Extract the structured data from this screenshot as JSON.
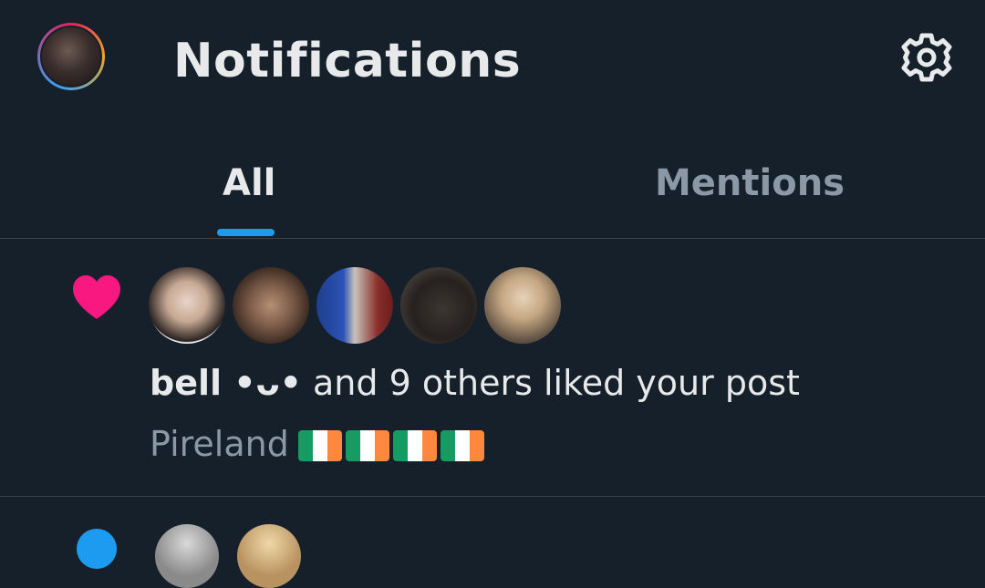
{
  "header": {
    "title": "Notifications",
    "settings_icon": "gear-icon"
  },
  "tabs": [
    {
      "label": "All",
      "selected": true
    },
    {
      "label": "Mentions",
      "selected": false
    }
  ],
  "notification": {
    "icon": "heart-icon",
    "name": "bell •ᴗ•",
    "action": " and 9 others liked your post",
    "post_text": "Pireland",
    "flag_count": 4
  },
  "colors": {
    "background": "#16202b",
    "accent": "#1d9bf0",
    "like": "#f91880",
    "muted": "#8b98a5"
  }
}
